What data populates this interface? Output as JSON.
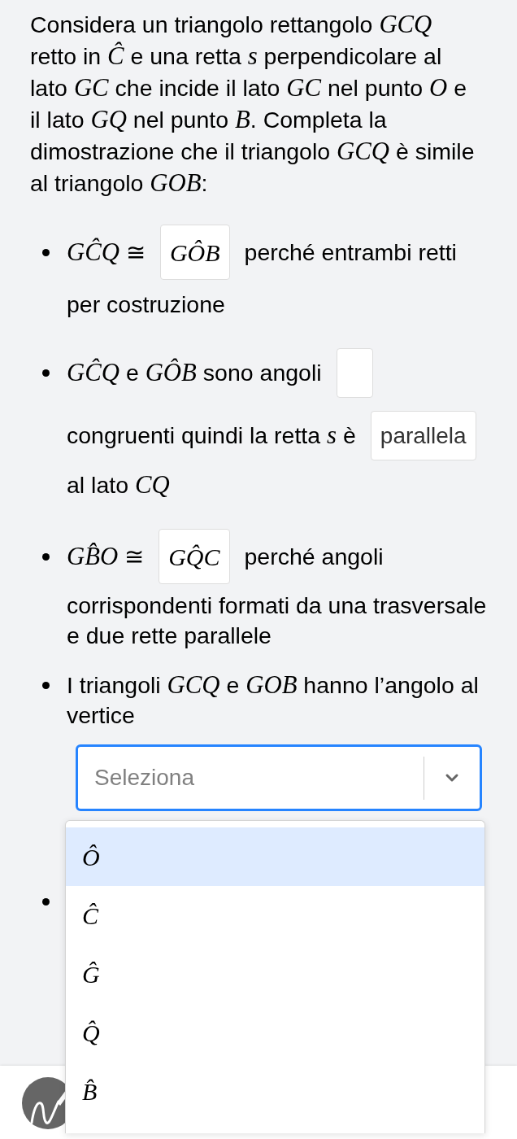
{
  "question": "Considera un triangolo rettangolo *GCQ* retto in *Ĉ* e una retta *s* perpendicolare al lato *GC* che incide il lato *GC* nel punto *O* e il lato *GQ* nel punto *B*. Completa la dimostrazione che il triangolo *GCQ* è simile al triangolo *GOB*:",
  "steps": [
    {
      "kind": "sentence",
      "lines": [
        [
          {
            "kind": "text",
            "text": "*GĈQ* ≅"
          },
          {
            "kind": "answer",
            "math": true,
            "value": "GÔB"
          },
          {
            "kind": "text",
            "text": "perché entrambi retti"
          }
        ],
        [
          {
            "kind": "text",
            "text": "per costruzione"
          }
        ]
      ]
    },
    {
      "kind": "sentence",
      "lines": [
        [
          {
            "kind": "text",
            "text": "*GĈQ* e *GÔB* sono angoli"
          },
          {
            "kind": "blank"
          }
        ],
        [
          {
            "kind": "text",
            "text": "congruenti quindi la retta *s* è"
          },
          {
            "kind": "answer",
            "math": false,
            "value": "parallela"
          }
        ],
        [
          {
            "kind": "text",
            "text": "al lato *CQ*"
          }
        ]
      ]
    },
    {
      "kind": "sentence",
      "lines": [
        [
          {
            "kind": "text",
            "text": "*GB̂O* ≅"
          },
          {
            "kind": "answer",
            "math": true,
            "value": "GQ̂C"
          },
          {
            "kind": "text",
            "text": "perché angoli"
          }
        ],
        [
          {
            "kind": "text",
            "text": "corrispondenti formati da una trasversale e due rette parallele"
          }
        ]
      ]
    },
    {
      "kind": "sentence",
      "lines": [
        [
          {
            "kind": "text",
            "text": "I triangoli *GCQ* e *GOB* hanno l’angolo al vertice"
          }
        ],
        [
          {
            "kind": "select",
            "placeholder": "Seleziona",
            "focused": true,
            "open": true,
            "options": [
              {
                "label": "Ô",
                "focused": true,
                "selected": false
              },
              {
                "label": "Ĉ",
                "focused": false,
                "selected": false
              },
              {
                "label": "Ĝ",
                "focused": false,
                "selected": false
              },
              {
                "label": "Q̂",
                "focused": false,
                "selected": false
              },
              {
                "label": "B̂",
                "focused": false,
                "selected": false
              }
            ]
          }
        ]
      ]
    },
    {
      "kind": "covered"
    }
  ]
}
